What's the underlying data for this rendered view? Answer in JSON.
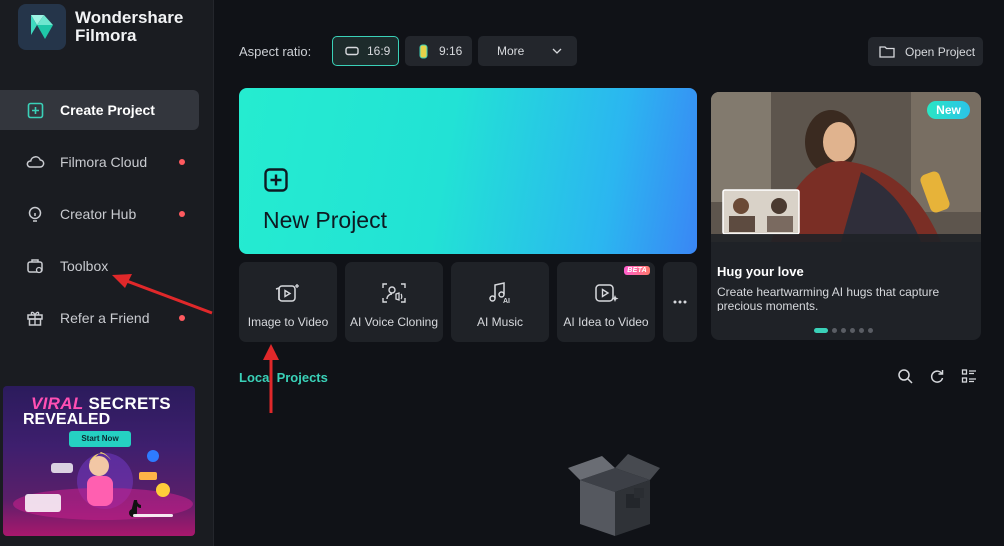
{
  "brand": {
    "line1": "Wondershare",
    "line2": "Filmora",
    "logo_icon": "filmora-logo-icon"
  },
  "sidebar": {
    "items": [
      {
        "id": "create-project",
        "label": "Create Project",
        "icon": "plus-square-icon",
        "active": true,
        "dot": false
      },
      {
        "id": "filmora-cloud",
        "label": "Filmora Cloud",
        "icon": "cloud-icon",
        "active": false,
        "dot": true
      },
      {
        "id": "creator-hub",
        "label": "Creator Hub",
        "icon": "bulb-icon",
        "active": false,
        "dot": true
      },
      {
        "id": "toolbox",
        "label": "Toolbox",
        "icon": "toolbox-icon",
        "active": false,
        "dot": false
      },
      {
        "id": "refer-a-friend",
        "label": "Refer a Friend",
        "icon": "gift-icon",
        "active": false,
        "dot": true
      }
    ]
  },
  "promo": {
    "word1": "VIRAL",
    "word2": "SECRETS",
    "word3": "REVEALED",
    "button": "Start Now"
  },
  "topbar": {
    "aspect_label": "Aspect ratio:",
    "ratio_16_9": "16:9",
    "ratio_9_16": "9:16",
    "more": "More",
    "open_project": "Open Project"
  },
  "hero": {
    "new_project": "New Project"
  },
  "tools": [
    {
      "id": "image-to-video",
      "label": "Image to Video",
      "icon": "image-to-video-icon"
    },
    {
      "id": "ai-voice-cloning",
      "label": "AI Voice Cloning",
      "icon": "voice-cloning-icon"
    },
    {
      "id": "ai-music",
      "label": "AI Music",
      "icon": "music-note-icon"
    },
    {
      "id": "ai-idea-to-video",
      "label": "AI Idea to Video",
      "icon": "idea-to-video-icon",
      "badge": "BETA"
    }
  ],
  "feature": {
    "badge": "New",
    "title": "Hug your love",
    "description": "Create heartwarming AI hugs that capture precious moments."
  },
  "local": {
    "title": "Local Projects"
  },
  "colors": {
    "accent": "#3ad1b8",
    "dot": "#ff5a5f",
    "arrow": "#e0282a"
  }
}
